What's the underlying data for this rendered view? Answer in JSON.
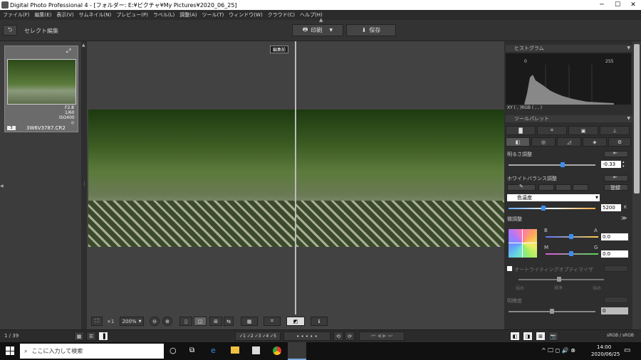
{
  "window": {
    "title": "Digital Photo Professional 4 - [フォルダー: E:¥ピクチャ¥My Pictures¥2020_06_25]"
  },
  "menu": [
    "ファイル(F)",
    "編集(E)",
    "表示(V)",
    "サムネイル(N)",
    "プレビュー(P)",
    "ラベル(L)",
    "調整(A)",
    "ツール(T)",
    "ウィンドウ(W)",
    "クラウド(C)",
    "ヘルプ(H)"
  ],
  "toolbar": {
    "mode_label": "セレクト編集",
    "print_label": "印刷",
    "save_label": "保存"
  },
  "thumbnail": {
    "info_line1": "F2.8",
    "info_line2": "1/60",
    "info_line3": "ISO400",
    "filename": "3W6V3787.CR2",
    "badge": "3"
  },
  "preview": {
    "before_label": "編集前"
  },
  "bottom_toolbar": {
    "zoom_value": "×1",
    "zoom_percent": "200%"
  },
  "histogram": {
    "title": "ヒストグラム",
    "min_label": "0",
    "max_label": "255",
    "readout": "XY (    ,     )RGB (   ,   ,   )"
  },
  "tool_palette": {
    "title": "ツールパレット",
    "brightness": {
      "label": "明るさ調整",
      "value": "-0.33",
      "level": 0.62
    },
    "white_balance": {
      "label": "ホワイトバランス調整",
      "register_label": "登録",
      "mode_value": "色温度",
      "temp_value": "5200",
      "temp_unit": "K",
      "temp_level": 0.4
    },
    "fine_tune": {
      "label": "微調整",
      "b_label": "B",
      "a_label": "A",
      "m_label": "M",
      "g_label": "G",
      "ba_value": "0.0",
      "mg_value": "0.0"
    },
    "auto_lighting": {
      "label": "オートライティングオプティマイザ",
      "low": "弱め",
      "std": "標準",
      "high": "強め"
    },
    "contrast": {
      "label": "明瞭度",
      "value": "0"
    }
  },
  "status": {
    "count": "1 / 39",
    "color_space": "sRGB / sRGB"
  },
  "taskbar": {
    "search_placeholder": "ここに入力して検索",
    "time": "14:00",
    "date": "2020/06/25"
  }
}
